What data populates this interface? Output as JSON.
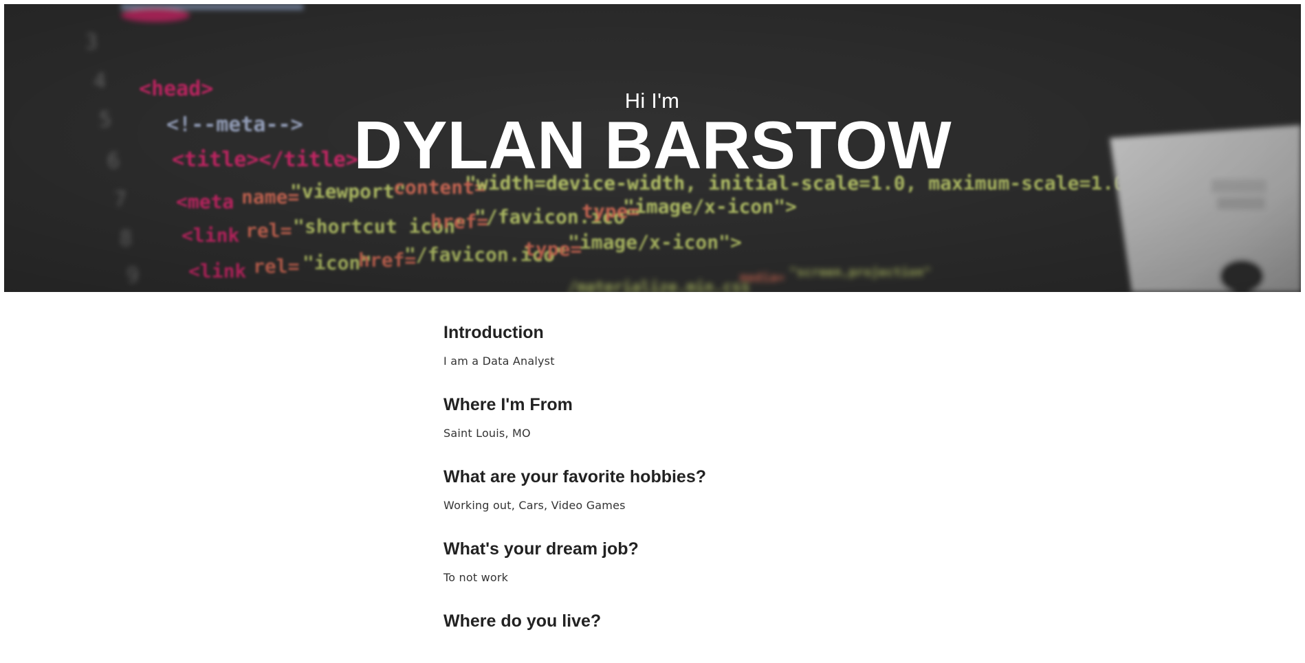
{
  "hero": {
    "greeting": "Hi I'm",
    "name": "DYLAN BARSTOW",
    "background": {
      "base_color": "#373737",
      "accent_colors": [
        "#ef2f7a",
        "#f07a63",
        "#d5e57a",
        "#b3c3e8",
        "#f0f0f0"
      ],
      "icon": "code-background-image"
    }
  },
  "sections": [
    {
      "heading": "Introduction",
      "body": "I am a Data Analyst"
    },
    {
      "heading": "Where I'm From",
      "body": "Saint Louis, MO"
    },
    {
      "heading": "What are your favorite hobbies?",
      "body": "Working out, Cars, Video Games"
    },
    {
      "heading": "What's your dream job?",
      "body": "To not work"
    },
    {
      "heading": "Where do you live?",
      "body": ""
    }
  ]
}
